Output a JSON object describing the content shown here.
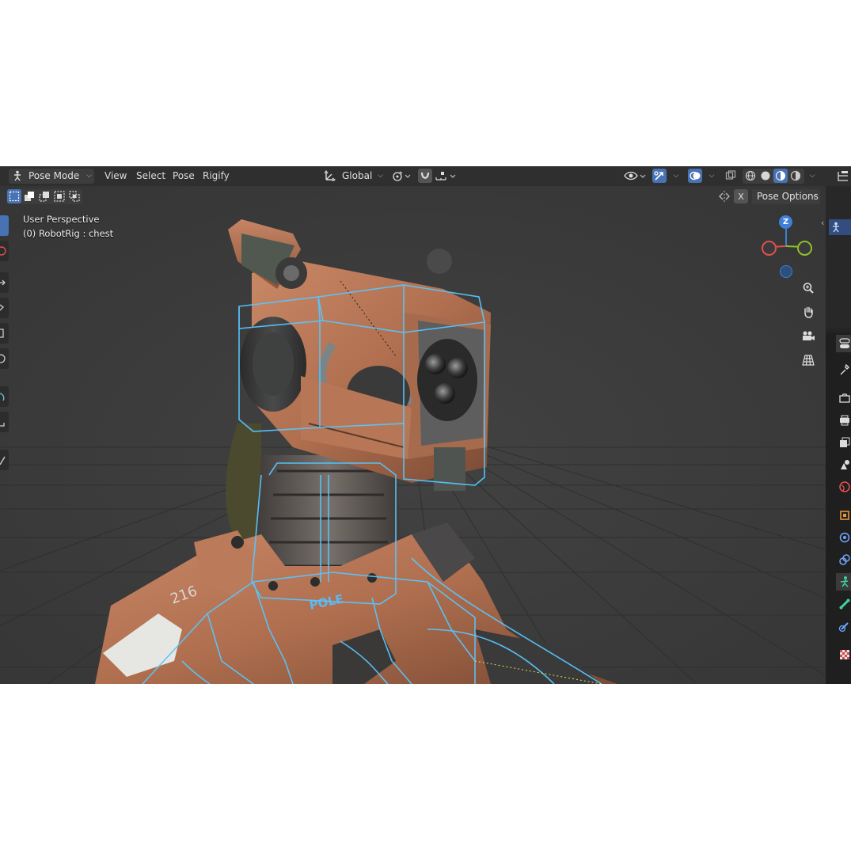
{
  "header": {
    "mode_label": "Pose Mode",
    "menus": [
      "View",
      "Select",
      "Pose",
      "Rigify"
    ],
    "transform_orientation": "Global"
  },
  "subheader": {
    "pose_options_label": "Pose Options",
    "x_label": "X"
  },
  "viewport": {
    "perspective_label": "User Perspective",
    "object_label": "(0) RobotRig : chest",
    "gizmo_z_label": "Z",
    "model_text_plate": "POLE",
    "model_text_shoulder": "216"
  },
  "colors": {
    "accent_blue": "#4772b3",
    "axis_x": "#e05050",
    "axis_y": "#8fbf2a",
    "axis_z": "#3f7fd6",
    "bone_wire": "#57c6ff",
    "header_bg": "#2f2f2f",
    "viewport_bg": "#3b3b3b"
  },
  "icons": {
    "mode": "pose-armature-icon",
    "orientation": "transform-orientation-icon",
    "pivot": "pivot-point-icon",
    "snap": "snap-magnet-icon",
    "visibility": "eye-icon",
    "gizmo": "gizmo-toggle-icon",
    "overlays": "overlays-icon",
    "xray": "xray-icon",
    "shading": [
      "wireframe-shading-icon",
      "solid-shading-icon",
      "material-shading-icon",
      "rendered-shading-icon"
    ],
    "nav": [
      "zoom-icon",
      "hand-pan-icon",
      "camera-icon",
      "grid-ortho-icon"
    ]
  }
}
